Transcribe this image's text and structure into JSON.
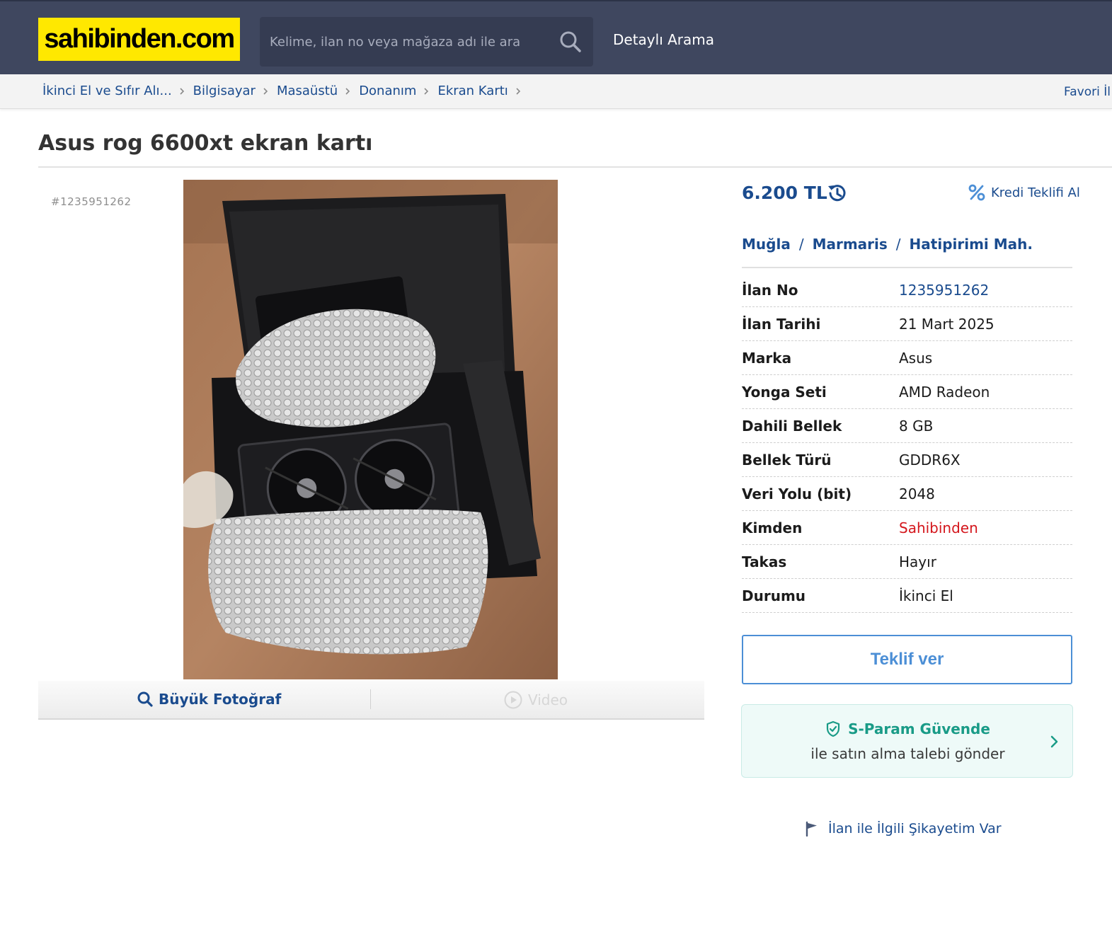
{
  "header": {
    "logo_text": "sahibinden.com",
    "search_placeholder": "Kelime, ilan no veya mağaza adı ile ara",
    "detailed_search": "Detaylı Arama"
  },
  "breadcrumb": {
    "items": [
      "İkinci El ve Sıfır Alı...",
      "Bilgisayar",
      "Masaüstü",
      "Donanım",
      "Ekran Kartı"
    ],
    "favori": "Favori İl"
  },
  "listing": {
    "title": "Asus rog 6600xt ekran kartı",
    "ad_no_label": "#1235951262",
    "price": "6.200 TL",
    "credit": "Kredi Teklifi Al",
    "location": [
      "Muğla",
      "Marmaris",
      "Hatipirimi Mah."
    ],
    "location_sep": "/",
    "attributes": [
      {
        "label": "İlan No",
        "value": "1235951262"
      },
      {
        "label": "İlan Tarihi",
        "value": "21 Mart 2025"
      },
      {
        "label": "Marka",
        "value": "Asus"
      },
      {
        "label": "Yonga Seti",
        "value": "AMD Radeon"
      },
      {
        "label": "Dahili Bellek",
        "value": "8 GB"
      },
      {
        "label": "Bellek Türü",
        "value": "GDDR6X"
      },
      {
        "label": "Veri Yolu (bit)",
        "value": "2048"
      },
      {
        "label": "Kimden",
        "value": "Sahibinden"
      },
      {
        "label": "Takas",
        "value": "Hayır"
      },
      {
        "label": "Durumu",
        "value": "İkinci El"
      }
    ],
    "offer_button": "Teklif ver",
    "sparam_title": "S-Param Güvende",
    "sparam_sub": "ile satın alma talebi gönder",
    "complaint": "İlan ile İlgili Şikayetim Var"
  },
  "media": {
    "big_photo": "Büyük Fotoğraf",
    "video": "Video"
  },
  "colors": {
    "header_bg": "#3f475f",
    "logo_bg": "#ffe800",
    "link_blue": "#1a4b8e",
    "sparam_green": "#199b87",
    "seller_red": "#d4161c"
  }
}
